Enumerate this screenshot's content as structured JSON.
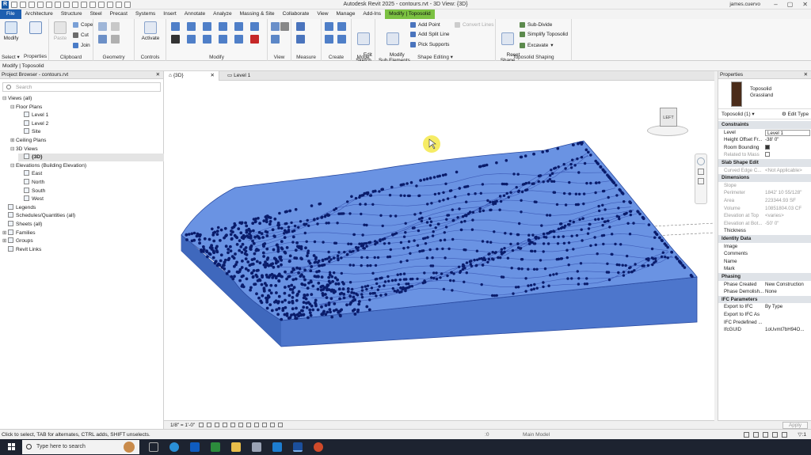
{
  "window": {
    "title": "Autodesk Revit 2025 - contours.rvt - 3D View: {3D}",
    "user": "james.cuervo",
    "logo": "R"
  },
  "tabs": [
    "File",
    "Architecture",
    "Structure",
    "Steel",
    "Precast",
    "Systems",
    "Insert",
    "Annotate",
    "Analyze",
    "Massing & Site",
    "Collaborate",
    "View",
    "Manage",
    "Add-Ins",
    "Modify | Toposolid"
  ],
  "ribbon": {
    "modify_label": "Modify",
    "select_label": "Select ▾",
    "properties_label": "Properties",
    "clipboard_label": "Clipboard",
    "paste_label": "Paste",
    "cope_label": "Cope",
    "cut_label": "Cut",
    "join_label": "Join",
    "geometry_label": "Geometry",
    "activate_label": "Activate",
    "controls_label": "Controls",
    "modify_panel_label": "Modify",
    "view_label": "View",
    "measure_label": "Measure",
    "create_label": "Create",
    "edit_sketch_label": "Edit\nSketch",
    "mode_label": "Mode",
    "modify_sub_label": "Modify\nSub Elements",
    "add_point_label": "Add Point",
    "add_split_line_label": "Add Split Line",
    "pick_supports_label": "Pick Supports",
    "convert_lines_label": "Convert Lines",
    "shape_editing_label": "Shape Editing",
    "reset_shape_label": "Reset\nShape",
    "sub_divide_label": "Sub-Divide",
    "simplify_label": "Simplify Toposolid",
    "excavate_label": "Excavate",
    "toposolid_shaping_label": "Toposolid Shaping"
  },
  "options_bar": "Modify | Toposolid",
  "project_browser": {
    "title": "Project Browser - contours.rvt",
    "close": "✕",
    "search_placeholder": "Search",
    "items": [
      {
        "ex": "⊟",
        "label": "Views (all)",
        "indent": 0,
        "icon": false,
        "selected": false
      },
      {
        "ex": "⊟",
        "label": "Floor Plans",
        "indent": 1,
        "icon": false,
        "selected": false
      },
      {
        "ex": "",
        "label": "Level 1",
        "indent": 2,
        "icon": true,
        "selected": false
      },
      {
        "ex": "",
        "label": "Level 2",
        "indent": 2,
        "icon": true,
        "selected": false
      },
      {
        "ex": "",
        "label": "Site",
        "indent": 2,
        "icon": true,
        "selected": false
      },
      {
        "ex": "⊞",
        "label": "Ceiling Plans",
        "indent": 1,
        "icon": false,
        "selected": false
      },
      {
        "ex": "⊟",
        "label": "3D Views",
        "indent": 1,
        "icon": false,
        "selected": false
      },
      {
        "ex": "",
        "label": "{3D}",
        "indent": 2,
        "icon": true,
        "selected": true
      },
      {
        "ex": "⊟",
        "label": "Elevations (Building Elevation)",
        "indent": 1,
        "icon": false,
        "selected": false
      },
      {
        "ex": "",
        "label": "East",
        "indent": 2,
        "icon": true,
        "selected": false
      },
      {
        "ex": "",
        "label": "North",
        "indent": 2,
        "icon": true,
        "selected": false
      },
      {
        "ex": "",
        "label": "South",
        "indent": 2,
        "icon": true,
        "selected": false
      },
      {
        "ex": "",
        "label": "West",
        "indent": 2,
        "icon": true,
        "selected": false
      },
      {
        "ex": "",
        "label": "Legends",
        "indent": 0,
        "icon": true,
        "selected": false
      },
      {
        "ex": "",
        "label": "Schedules/Quantities (all)",
        "indent": 0,
        "icon": true,
        "selected": false
      },
      {
        "ex": "",
        "label": "Sheets (all)",
        "indent": 0,
        "icon": true,
        "selected": false
      },
      {
        "ex": "⊞",
        "label": "Families",
        "indent": 0,
        "icon": true,
        "selected": false
      },
      {
        "ex": "⊞",
        "label": "Groups",
        "indent": 0,
        "icon": true,
        "selected": false
      },
      {
        "ex": "",
        "label": "Revit Links",
        "indent": 0,
        "icon": true,
        "selected": false
      }
    ]
  },
  "view_tabs": {
    "active": "{3D}",
    "active_close": "✕",
    "other": "Level 1"
  },
  "viewcube": {
    "face": "LEFT"
  },
  "view_control": {
    "scale": "1/8\" = 1'-0\""
  },
  "properties": {
    "title": "Properties",
    "close": "✕",
    "type_name": "Toposolid",
    "type_sub": "Grassland",
    "instance_label": "Toposolid (1)",
    "edit_type": "Edit Type",
    "rows": [
      {
        "kind": "group",
        "k": "Constraints"
      },
      {
        "kind": "row",
        "k": "Level",
        "v": "Level 1",
        "box": true
      },
      {
        "kind": "row",
        "k": "Height Offset Fr...",
        "v": "-38'  0\""
      },
      {
        "kind": "row",
        "k": "Room Bounding",
        "v": "",
        "check": "on"
      },
      {
        "kind": "grey",
        "k": "Related to Mass",
        "v": "",
        "check": "off"
      },
      {
        "kind": "group",
        "k": "Slab Shape Edit"
      },
      {
        "kind": "grey",
        "k": "Curved Edge C...",
        "v": "<Not Applicable>"
      },
      {
        "kind": "group",
        "k": "Dimensions"
      },
      {
        "kind": "grey",
        "k": "Slope",
        "v": ""
      },
      {
        "kind": "grey",
        "k": "Perimeter",
        "v": "1842'  10 55/128\""
      },
      {
        "kind": "grey",
        "k": "Area",
        "v": "223344.93 SF"
      },
      {
        "kind": "grey",
        "k": "Volume",
        "v": "10851804.03 CF"
      },
      {
        "kind": "grey",
        "k": "Elevation at Top",
        "v": "<varies>"
      },
      {
        "kind": "grey",
        "k": "Elevation at Bot...",
        "v": "-50'  0\""
      },
      {
        "kind": "row",
        "k": "Thickness",
        "v": ""
      },
      {
        "kind": "group",
        "k": "Identity Data"
      },
      {
        "kind": "row",
        "k": "Image",
        "v": ""
      },
      {
        "kind": "row",
        "k": "Comments",
        "v": ""
      },
      {
        "kind": "row",
        "k": "Name",
        "v": ""
      },
      {
        "kind": "row",
        "k": "Mark",
        "v": ""
      },
      {
        "kind": "group",
        "k": "Phasing"
      },
      {
        "kind": "row",
        "k": "Phase Created",
        "v": "New Construction"
      },
      {
        "kind": "row",
        "k": "Phase Demolish...",
        "v": "None"
      },
      {
        "kind": "group",
        "k": "IFC Parameters"
      },
      {
        "kind": "row",
        "k": "Export to IFC",
        "v": "By Type"
      },
      {
        "kind": "row",
        "k": "Export to IFC As",
        "v": ""
      },
      {
        "kind": "row",
        "k": "IFC Predefined ...",
        "v": ""
      },
      {
        "kind": "row",
        "k": "IfcGUID",
        "v": "1oUvmt7bH94O..."
      }
    ],
    "apply": "Apply"
  },
  "status": {
    "text": "Click to select, TAB for alternates, CTRL adds, SHIFT unselects.",
    "coords": ":0",
    "model": "Main Model",
    "filter": "▽:1"
  },
  "taskbar": {
    "search_placeholder": "Type here to search"
  },
  "colors": {
    "file_tab": "#1e5fb0",
    "context_tab": "#7bc142",
    "toposolid": "#5b84d8",
    "contour": "#3e5cb8",
    "points": "#0a1c6b"
  }
}
